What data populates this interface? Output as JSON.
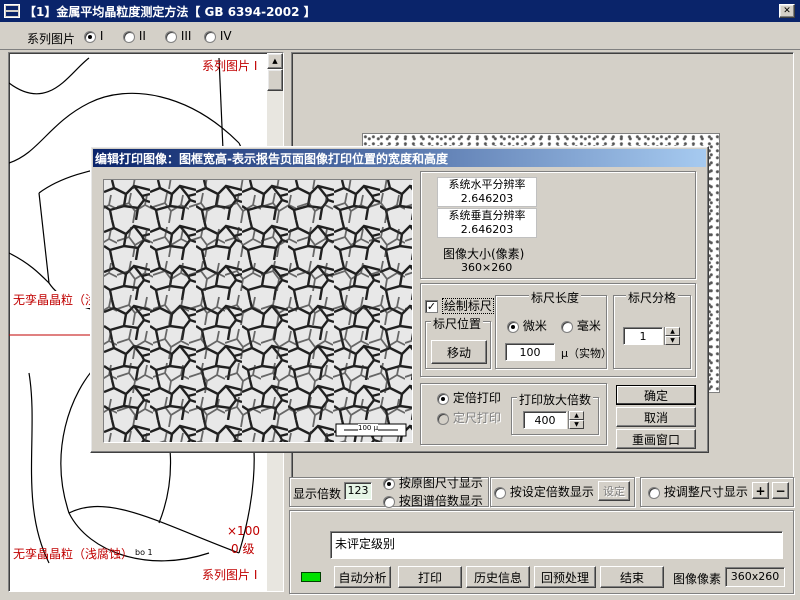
{
  "window": {
    "title": "【1】金属平均晶粒度测定方法【 GB 6394-2002 】"
  },
  "series": {
    "label": "系列图片",
    "options": [
      "I",
      "II",
      "III",
      "IV"
    ],
    "selected": 0
  },
  "left_panel": {
    "caption_top": "系列图片 I",
    "caption_mid": "无孪晶晶粒（浅腐蚀）",
    "mag": "×100",
    "grade": "0  级",
    "caption_bottom_left": "无孪晶晶粒（浅腐蚀）",
    "caption_bottom_right": "系列图片 I",
    "scale_tag": "bo 1"
  },
  "dialog": {
    "title": "编辑打印图像：图框宽高-表示报告页面图像打印位置的宽度和高度",
    "h_res_label": "系统水平分辨率",
    "h_res_value": "2.646203",
    "v_res_label": "系统垂直分辨率",
    "v_res_value": "2.646203",
    "size_label": "图像大小(像素)",
    "size_value": "360×260",
    "draw_scale_label": "绘制标尺",
    "draw_scale_checked": true,
    "scale_pos_label": "标尺位置",
    "move_btn": "移动",
    "scale_len_label": "标尺长度",
    "unit_micron": "微米",
    "unit_mm": "毫米",
    "unit_selected": "微米",
    "scale_len_value": "100",
    "scale_len_unit": "μ（实物）",
    "scale_div_label": "标尺分格",
    "scale_div_value": "1",
    "fixed_mag_print": "定倍打印",
    "fixed_size_print": "定尺打印",
    "print_mag_label": "打印放大倍数",
    "print_mag_value": "400",
    "ok_btn": "确定",
    "cancel_btn": "取消",
    "redraw_btn": "重画窗口",
    "image_scalebar": "100 μ"
  },
  "display": {
    "mag_label": "显示倍数",
    "mag_value": "123",
    "opt_original": "按原图尺寸显示",
    "opt_chart": "按图谱倍数显示",
    "opt_set": "按设定倍数显示",
    "set_btn": "设定",
    "opt_adjust": "按调整尺寸显示",
    "selected": "按原图尺寸显示"
  },
  "status": {
    "grade_text": "未评定级别"
  },
  "toolbar": {
    "auto_btn": "自动分析",
    "print_btn": "打印",
    "history_btn": "历史信息",
    "preprocess_btn": "回预处理",
    "end_btn": "结束",
    "pixel_label": "图像像素",
    "pixel_value": "360x260"
  }
}
